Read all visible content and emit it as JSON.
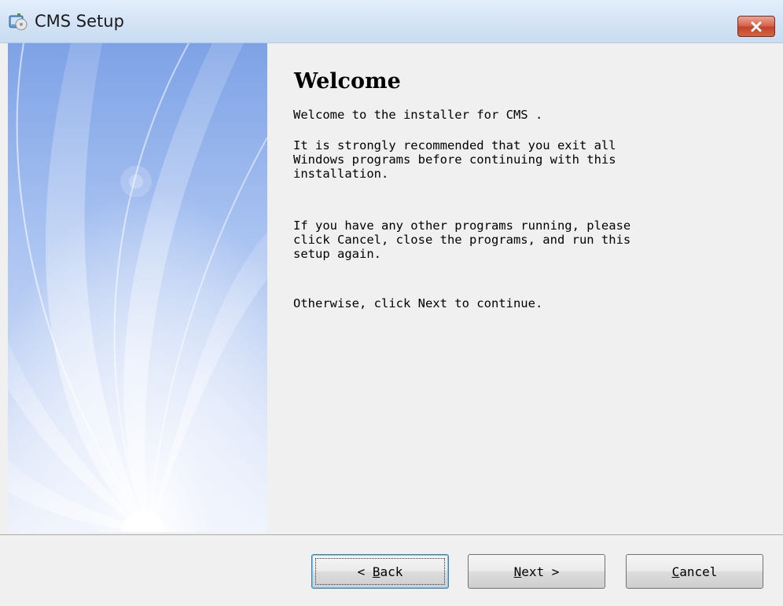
{
  "window": {
    "title": "CMS Setup"
  },
  "content": {
    "heading": "Welcome",
    "paragraphs": [
      "Welcome to the installer for CMS .",
      "It is strongly recommended that you exit all\nWindows programs before continuing with this\ninstallation.",
      "If you have any other programs running, please\nclick Cancel, close the programs, and run this\nsetup again.",
      "Otherwise, click Next to continue."
    ]
  },
  "buttons": {
    "back": {
      "label": "< Back",
      "mnemonic": "B"
    },
    "next": {
      "label": "Next >",
      "mnemonic": "N"
    },
    "cancel": {
      "label": "Cancel",
      "mnemonic": "C"
    }
  },
  "icons": {
    "app": "installer-icon",
    "close": "close-icon"
  },
  "colors": {
    "titlebar": "#d6e5f6",
    "close_button": "#d9674d",
    "side_panel": "#a4bff0",
    "dialog_bg": "#f0f0f0"
  }
}
